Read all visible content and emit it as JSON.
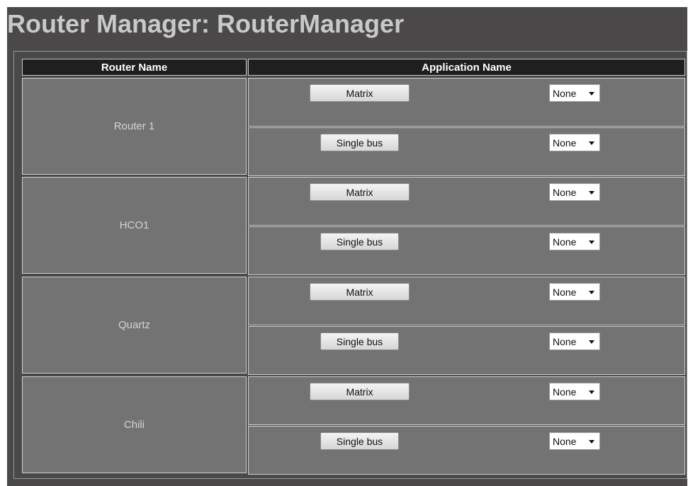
{
  "title": "Router Manager: RouterManager",
  "headers": {
    "router_name": "Router Name",
    "application_name": "Application Name"
  },
  "routers": [
    {
      "name": "Router 1",
      "apps": [
        {
          "label": "Matrix",
          "value": "None"
        },
        {
          "label": "Single bus",
          "value": "None"
        }
      ]
    },
    {
      "name": "HCO1",
      "apps": [
        {
          "label": "Matrix",
          "value": "None"
        },
        {
          "label": "Single bus",
          "value": "None"
        }
      ]
    },
    {
      "name": "Quartz",
      "apps": [
        {
          "label": "Matrix",
          "value": "None"
        },
        {
          "label": "Single bus",
          "value": "None"
        }
      ]
    },
    {
      "name": "Chili",
      "apps": [
        {
          "label": "Matrix",
          "value": "None"
        },
        {
          "label": "Single bus",
          "value": "None"
        }
      ]
    }
  ]
}
